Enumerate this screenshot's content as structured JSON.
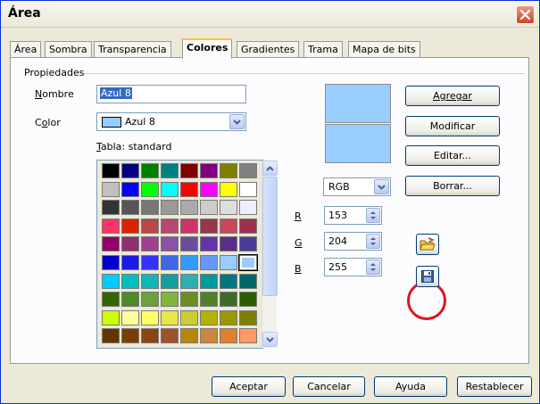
{
  "window": {
    "title": "Área"
  },
  "tabs": [
    {
      "label": "Área",
      "active": false
    },
    {
      "label": "Sombra",
      "active": false
    },
    {
      "label": "Transparencia",
      "active": false
    },
    {
      "label": "Colores",
      "active": true
    },
    {
      "label": "Gradientes",
      "active": false
    },
    {
      "label": "Trama",
      "active": false
    },
    {
      "label": "Mapa de bits",
      "active": false
    }
  ],
  "properties": {
    "group_label": "Propiedades",
    "name_label": "Nombre",
    "name_value": "Azul 8",
    "color_label": "Color",
    "color_value": "Azul 8",
    "color_swatch": "#99CCFF",
    "table_label": "Tabla: standard"
  },
  "palette": [
    [
      "#000000",
      "#000080",
      "#008000",
      "#008080",
      "#800000",
      "#800080",
      "#808000",
      "#808080"
    ],
    [
      "#C0C0C0",
      "#0000FF",
      "#00FF00",
      "#00FFFF",
      "#FF0000",
      "#FF00FF",
      "#FFFF00",
      "#FFFFFF"
    ],
    [
      "#333333",
      "#555555",
      "#777777",
      "#999999",
      "#AAAAAA",
      "#CCCCCC",
      "#DDDDDD",
      "#EEEEFF"
    ],
    [
      "#FF3366",
      "#DC2300",
      "#B84747",
      "#B84770",
      "#CC3366",
      "#99364D",
      "#C6495B",
      "#9C2F52"
    ],
    [
      "#94006B",
      "#8F2F71",
      "#9F4090",
      "#8C52A8",
      "#6B4D99",
      "#6633AA",
      "#5A2E8A",
      "#4B3C99"
    ],
    [
      "#0000CC",
      "#1A1AE6",
      "#3333FF",
      "#3D68E6",
      "#3399FF",
      "#6699FF",
      "#99CCFF",
      "#99CCFF"
    ],
    [
      "#00CCFF",
      "#00C0C0",
      "#0FB7B7",
      "#159E9E",
      "#2DAFAF",
      "#00999C",
      "#007780",
      "#006666"
    ],
    [
      "#336600",
      "#4C8A2A",
      "#6BA13E",
      "#82B43C",
      "#6B8E23",
      "#51802B",
      "#3D6B25",
      "#2E5C00"
    ],
    [
      "#CCFF00",
      "#FFFF99",
      "#FFFF66",
      "#E6E64C",
      "#CCCC33",
      "#B3B300",
      "#999900",
      "#808000"
    ],
    [
      "#663300",
      "#7A3E00",
      "#8B4513",
      "#A0522D",
      "#B8860B",
      "#CD853F",
      "#E08030",
      "#FF9966"
    ]
  ],
  "selected_swatch": {
    "row": 5,
    "col": 7
  },
  "preview_color": "#99CCFF",
  "actions": {
    "add": "Agregar",
    "modify": "Modificar",
    "edit": "Editar...",
    "delete": "Borrar..."
  },
  "color_model": "RGB",
  "rgb": {
    "r_label": "R",
    "r_value": "153",
    "g_label": "G",
    "g_value": "204",
    "b_label": "B",
    "b_value": "255"
  },
  "icons": {
    "load": "open-folder-icon",
    "save": "floppy-disk-icon"
  },
  "footer": {
    "ok": "Aceptar",
    "cancel": "Cancelar",
    "help": "Ayuda",
    "reset": "Restablecer"
  }
}
